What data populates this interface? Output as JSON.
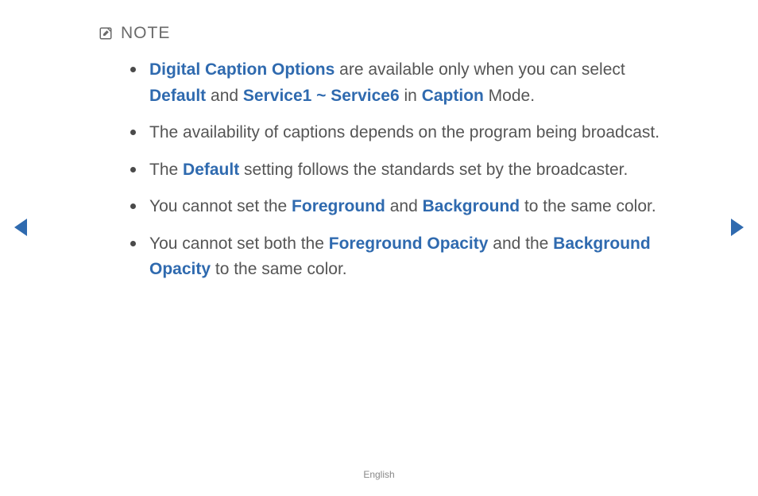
{
  "note": {
    "label": "NOTE"
  },
  "bullets": [
    {
      "seg": [
        {
          "t": "Digital Caption Options",
          "kw": true
        },
        {
          "t": " are available only when you can select ",
          "kw": false
        },
        {
          "t": "Default",
          "kw": true
        },
        {
          "t": " and ",
          "kw": false
        },
        {
          "t": "Service1 ~ Service6",
          "kw": true
        },
        {
          "t": " in ",
          "kw": false
        },
        {
          "t": "Caption",
          "kw": true
        },
        {
          "t": " Mode.",
          "kw": false
        }
      ]
    },
    {
      "seg": [
        {
          "t": "The availability of captions depends on the program being broadcast.",
          "kw": false
        }
      ]
    },
    {
      "seg": [
        {
          "t": "The ",
          "kw": false
        },
        {
          "t": "Default",
          "kw": true
        },
        {
          "t": " setting follows the standards set by the broadcaster.",
          "kw": false
        }
      ]
    },
    {
      "seg": [
        {
          "t": "You cannot set the ",
          "kw": false
        },
        {
          "t": "Foreground",
          "kw": true
        },
        {
          "t": " and ",
          "kw": false
        },
        {
          "t": "Background",
          "kw": true
        },
        {
          "t": " to the same color.",
          "kw": false
        }
      ]
    },
    {
      "seg": [
        {
          "t": "You cannot set both the ",
          "kw": false
        },
        {
          "t": "Foreground Opacity",
          "kw": true
        },
        {
          "t": " and the ",
          "kw": false
        },
        {
          "t": "Background Opacity",
          "kw": true
        },
        {
          "t": " to the same color.",
          "kw": false
        }
      ]
    }
  ],
  "footer": {
    "language": "English"
  }
}
